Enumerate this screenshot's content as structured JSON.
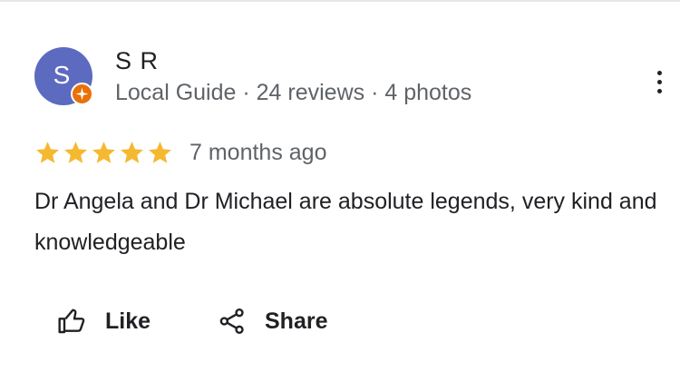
{
  "reviewer": {
    "initial": "S",
    "name": "S R",
    "meta": "Local Guide · 24 reviews · 4 photos",
    "avatar_color": "#5c6bc0",
    "badge_color": "#e8710a",
    "badge_icon": "local-guide-star-icon"
  },
  "review": {
    "rating": 5,
    "rating_max": 5,
    "star_color": "#f5b831",
    "date": "7 months ago",
    "text": "Dr Angela and Dr Michael are absolute legends, very kind and knowledgeable"
  },
  "actions": {
    "like_label": "Like",
    "like_icon": "thumbs-up-icon",
    "share_label": "Share",
    "share_icon": "share-icon",
    "more_icon": "more-vertical-icon"
  }
}
